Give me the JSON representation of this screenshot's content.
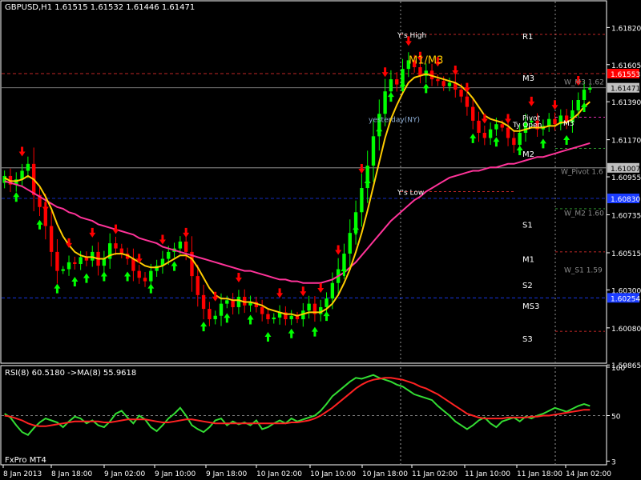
{
  "window": {
    "title": "GBPUSD,H1  1.61515 1.61532 1.61446 1.61471",
    "brand": "FxPro MT4"
  },
  "colors": {
    "background": "#000000",
    "bull": "#00ff00",
    "bear": "#ff0000",
    "ma_fast": "#ffcc00",
    "ma_slow": "#ff3399",
    "rsi": "#33dd33",
    "rsi_ma": "#ff2222",
    "pivot_blue": "#1a3cff",
    "pivot_red": "#ff3333",
    "grid_dots": "#bbbbbb"
  },
  "chart_data": [
    {
      "type": "candlestick",
      "symbol": "GBPUSD",
      "timeframe": "H1",
      "ylim": [
        1.5988,
        1.6197
      ],
      "y_ticks": [
        "1.61820",
        "1.61605",
        "1.61390",
        "1.61170",
        "1.60955",
        "1.60735",
        "1.60515",
        "1.60300",
        "1.60080",
        "1.59865"
      ],
      "y_tick_values": [
        1.6182,
        1.61605,
        1.6139,
        1.6117,
        1.60955,
        1.60735,
        1.60515,
        1.603,
        1.6008,
        1.59865
      ],
      "x_ticks": [
        "8 Jan 2013",
        "8 Jan 18:00",
        "9 Jan 02:00",
        "9 Jan 10:00",
        "9 Jan 18:00",
        "10 Jan 02:00",
        "10 Jan 10:00",
        "10 Jan 18:00",
        "11 Jan 02:00",
        "11 Jan 10:00",
        "11 Jan 18:00",
        "14 Jan 02:00"
      ],
      "price_flags": [
        {
          "label": "1.61553",
          "value": 1.61553,
          "color": "#ff0000",
          "text_color": "#ffffff"
        },
        {
          "label": "1.61471",
          "value": 1.61471,
          "color": "#c0c0c0",
          "text_color": "#000000"
        },
        {
          "label": "1.61007",
          "value": 1.61007,
          "color": "#c0c0c0",
          "text_color": "#000000"
        },
        {
          "label": "1.60830",
          "value": 1.6083,
          "color": "#1a3cff",
          "text_color": "#ffffff"
        },
        {
          "label": "1.60254",
          "value": 1.60254,
          "color": "#1a3cff",
          "text_color": "#ffffff"
        }
      ],
      "pivot_labels": [
        {
          "text": "R1",
          "value": 1.6177
        },
        {
          "text": "M3",
          "value": 1.6153
        },
        {
          "text": "M2",
          "value": 1.6109
        },
        {
          "text": "S1",
          "value": 1.6068
        },
        {
          "text": "M1",
          "value": 1.6048
        },
        {
          "text": "S2",
          "value": 1.6033
        },
        {
          "text": "MS3",
          "value": 1.6021
        },
        {
          "text": "S3",
          "value": 1.6002
        }
      ],
      "annotations": [
        {
          "text": "Y's High",
          "value": 1.6178,
          "color": "#ffffff"
        },
        {
          "text": "M1/M3",
          "value": 1.6163,
          "color": "#ffcc00"
        },
        {
          "text": "yesterday(NY)",
          "value": 1.6129,
          "color": "#8fb0d8"
        },
        {
          "text": "Y's Low",
          "value": 1.6087,
          "color": "#ffffff"
        },
        {
          "text": "W_M3 1.62",
          "value": 1.6151,
          "color": "#8a8a8a"
        },
        {
          "text": "W_Pivot 1.6",
          "value": 1.6099,
          "color": "#8a8a8a"
        },
        {
          "text": "W_M2 1.60",
          "value": 1.6075,
          "color": "#8a8a8a"
        },
        {
          "text": "W_S1 1.59",
          "value": 1.6042,
          "color": "#8a8a8a"
        },
        {
          "text": "Pivot",
          "value": 1.613,
          "color": "#ffffff"
        },
        {
          "text": "Ty Open",
          "value": 1.6126,
          "color": "#ffffff"
        },
        {
          "text": "M3",
          "value": 1.6127,
          "color": "#ffffff"
        }
      ],
      "horizontal_lines": [
        {
          "value": 1.61553,
          "color": "#ff3333",
          "style": "dashed"
        },
        {
          "value": 1.61471,
          "color": "#888888",
          "style": "solid"
        },
        {
          "value": 1.61007,
          "color": "#aaaaaa",
          "style": "solid"
        },
        {
          "value": 1.6083,
          "color": "#1a3cff",
          "style": "dashed"
        },
        {
          "value": 1.60254,
          "color": "#1a3cff",
          "style": "dashed"
        }
      ],
      "candles_close": [
        1.6096,
        1.6091,
        1.6094,
        1.6099,
        1.6103,
        1.6085,
        1.6078,
        1.6067,
        1.6052,
        1.6041,
        1.6042,
        1.6046,
        1.6045,
        1.6049,
        1.6047,
        1.6052,
        1.6044,
        1.6048,
        1.6057,
        1.6054,
        1.6051,
        1.6048,
        1.6041,
        1.6037,
        1.6035,
        1.6041,
        1.6044,
        1.6048,
        1.6052,
        1.6054,
        1.6058,
        1.6052,
        1.6038,
        1.6027,
        1.6019,
        1.6013,
        1.6015,
        1.6022,
        1.6024,
        1.602,
        1.6026,
        1.6021,
        1.6023,
        1.602,
        1.6016,
        1.6013,
        1.6014,
        1.6017,
        1.6013,
        1.6015,
        1.6013,
        1.6018,
        1.6022,
        1.6016,
        1.602,
        1.6025,
        1.6034,
        1.6042,
        1.6051,
        1.6063,
        1.6075,
        1.6089,
        1.6102,
        1.6119,
        1.6132,
        1.6145,
        1.6152,
        1.6149,
        1.6158,
        1.6163,
        1.6159,
        1.6154,
        1.6157,
        1.6152,
        1.6151,
        1.6148,
        1.615,
        1.6146,
        1.6142,
        1.6136,
        1.6128,
        1.6121,
        1.6118,
        1.6123,
        1.6126,
        1.6124,
        1.6118,
        1.6114,
        1.6121,
        1.6127,
        1.6128,
        1.6123,
        1.6125,
        1.6129,
        1.6126,
        1.6131,
        1.6127,
        1.6134,
        1.614,
        1.6146,
        1.6147
      ],
      "ma_fast": [
        1.6095,
        1.6093,
        1.6093,
        1.6094,
        1.6096,
        1.6094,
        1.609,
        1.6084,
        1.6077,
        1.6068,
        1.6061,
        1.6056,
        1.6052,
        1.605,
        1.6049,
        1.6049,
        1.6048,
        1.6048,
        1.605,
        1.6051,
        1.6051,
        1.605,
        1.6048,
        1.6046,
        1.6044,
        1.6043,
        1.6043,
        1.6044,
        1.6046,
        1.6048,
        1.605,
        1.605,
        1.6048,
        1.6043,
        1.6037,
        1.6031,
        1.6027,
        1.6025,
        1.6025,
        1.6024,
        1.6024,
        1.6023,
        1.6023,
        1.6022,
        1.6021,
        1.6019,
        1.6018,
        1.6017,
        1.6016,
        1.6016,
        1.6015,
        1.6016,
        1.6017,
        1.6017,
        1.6017,
        1.6019,
        1.6022,
        1.6027,
        1.6034,
        1.6042,
        1.6052,
        1.6063,
        1.6076,
        1.609,
        1.6104,
        1.6118,
        1.6129,
        1.6137,
        1.6144,
        1.615,
        1.6153,
        1.6154,
        1.6155,
        1.6154,
        1.6153,
        1.6152,
        1.6151,
        1.615,
        1.6148,
        1.6145,
        1.6141,
        1.6136,
        1.6131,
        1.6129,
        1.6128,
        1.6127,
        1.6125,
        1.6122,
        1.6122,
        1.6123,
        1.6124,
        1.6124,
        1.6124,
        1.6125,
        1.6125,
        1.6127,
        1.6127,
        1.6129,
        1.6132,
        1.6136,
        1.6139
      ],
      "ma_slow": [
        1.6093,
        1.6092,
        1.6091,
        1.609,
        1.6088,
        1.6086,
        1.6084,
        1.6082,
        1.608,
        1.6078,
        1.6077,
        1.6075,
        1.6074,
        1.6072,
        1.6071,
        1.607,
        1.6068,
        1.6067,
        1.6066,
        1.6065,
        1.6064,
        1.6063,
        1.6062,
        1.606,
        1.6059,
        1.6058,
        1.6057,
        1.6055,
        1.6054,
        1.6053,
        1.6052,
        1.6051,
        1.605,
        1.6049,
        1.6048,
        1.6047,
        1.6046,
        1.6045,
        1.6044,
        1.6043,
        1.6042,
        1.6041,
        1.6041,
        1.604,
        1.6039,
        1.6038,
        1.6037,
        1.6036,
        1.6036,
        1.6035,
        1.6035,
        1.6034,
        1.6034,
        1.6034,
        1.6034,
        1.6035,
        1.6036,
        1.6038,
        1.604,
        1.6043,
        1.6046,
        1.605,
        1.6054,
        1.6058,
        1.6062,
        1.6066,
        1.607,
        1.6073,
        1.6076,
        1.6079,
        1.6082,
        1.6084,
        1.6087,
        1.6089,
        1.6091,
        1.6093,
        1.6095,
        1.6096,
        1.6097,
        1.6098,
        1.6099,
        1.6099,
        1.61,
        1.6101,
        1.6101,
        1.6102,
        1.6103,
        1.6103,
        1.6104,
        1.6105,
        1.6106,
        1.6107,
        1.6107,
        1.6108,
        1.6109,
        1.611,
        1.6111,
        1.6112,
        1.6113,
        1.6114,
        1.6115
      ],
      "up_arrows": [
        2,
        6,
        9,
        12,
        14,
        17,
        21,
        25,
        29,
        34,
        38,
        42,
        45,
        49,
        53,
        55,
        58,
        60,
        62,
        64,
        66,
        68,
        72,
        80,
        84,
        88,
        92,
        96,
        99
      ],
      "down_arrows": [
        3,
        7,
        11,
        15,
        19,
        23,
        27,
        31,
        36,
        40,
        47,
        51,
        54,
        57,
        61,
        65,
        69,
        71,
        74,
        77,
        79,
        82,
        86,
        90,
        94,
        98
      ]
    },
    {
      "type": "line",
      "title": "RSI(8) 60.5180  ->MA(8) 55.9618",
      "ylim": [
        0,
        100
      ],
      "y_ticks": [
        "100",
        "50",
        "3"
      ],
      "series": [
        {
          "name": "RSI(8)",
          "color": "#33dd33",
          "values": [
            52,
            48,
            40,
            33,
            30,
            37,
            43,
            47,
            45,
            43,
            38,
            44,
            49,
            47,
            42,
            45,
            40,
            38,
            44,
            52,
            55,
            48,
            42,
            50,
            46,
            38,
            34,
            40,
            47,
            52,
            58,
            50,
            40,
            36,
            33,
            38,
            45,
            47,
            40,
            44,
            41,
            43,
            40,
            45,
            36,
            38,
            42,
            45,
            42,
            47,
            44,
            46,
            48,
            50,
            55,
            62,
            70,
            75,
            80,
            85,
            89,
            88,
            90,
            92,
            89,
            87,
            85,
            82,
            80,
            76,
            72,
            70,
            68,
            66,
            60,
            55,
            50,
            44,
            40,
            36,
            40,
            45,
            48,
            42,
            38,
            44,
            46,
            48,
            44,
            49,
            47,
            50,
            52,
            55,
            58,
            56,
            54,
            57,
            60,
            62,
            60
          ]
        },
        {
          "name": "MA(8)",
          "color": "#ff2222",
          "values": [
            50,
            49,
            47,
            45,
            42,
            40,
            39,
            39,
            40,
            41,
            42,
            43,
            44,
            44,
            44,
            44,
            44,
            43,
            43,
            44,
            45,
            46,
            46,
            46,
            46,
            45,
            44,
            43,
            43,
            44,
            45,
            46,
            46,
            45,
            44,
            43,
            42,
            42,
            42,
            42,
            42,
            42,
            42,
            42,
            42,
            42,
            42,
            42,
            42,
            43,
            43,
            44,
            45,
            47,
            50,
            54,
            58,
            63,
            68,
            73,
            78,
            82,
            85,
            87,
            88,
            89,
            89,
            88,
            87,
            85,
            83,
            80,
            78,
            75,
            72,
            68,
            64,
            60,
            56,
            52,
            50,
            48,
            47,
            47,
            47,
            47,
            48,
            48,
            48,
            48,
            49,
            49,
            50,
            50,
            51,
            52,
            53,
            54,
            55,
            56,
            56
          ]
        }
      ]
    }
  ]
}
